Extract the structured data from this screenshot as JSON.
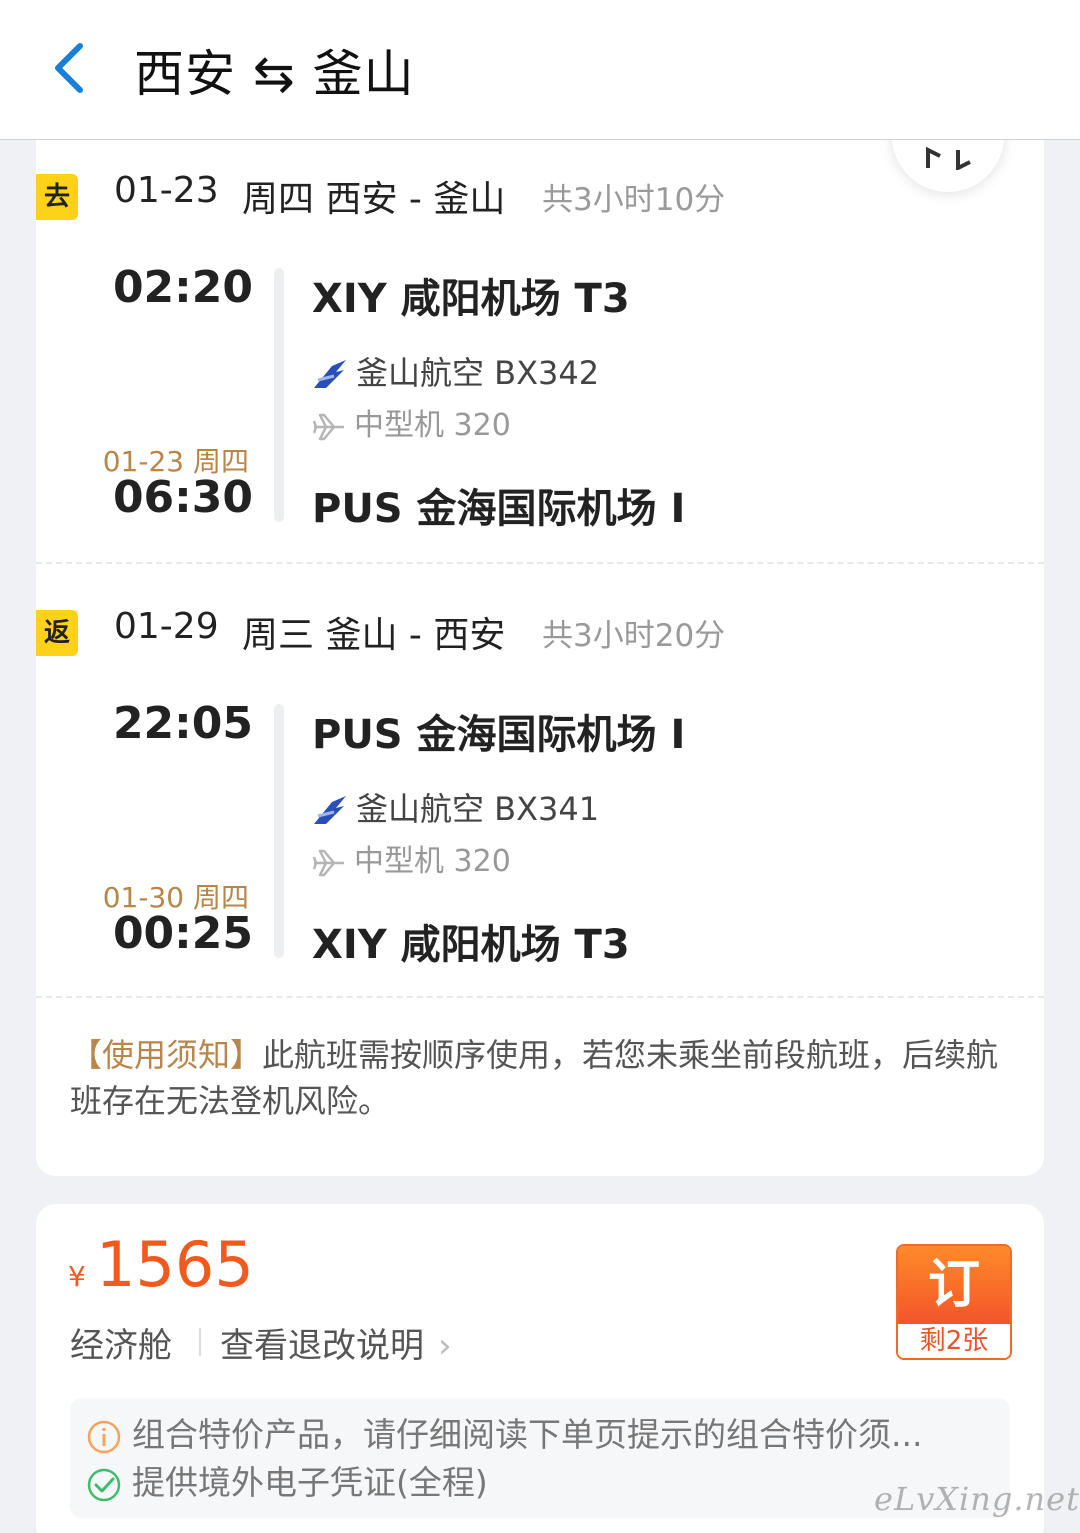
{
  "header": {
    "title": "西安 ⇆ 釜山"
  },
  "outbound": {
    "badge": "去",
    "date": "01-23",
    "route": "周四 西安 - 釜山",
    "duration": "共3小时10分",
    "dep_time": "02:20",
    "dep_airport": "XIY 咸阳机场 T3",
    "airline": "釜山航空 BX342",
    "aircraft": "中型机 320",
    "arr_date": "01-23 周四",
    "arr_time": "06:30",
    "arr_airport": "PUS 金海国际机场 I"
  },
  "return": {
    "badge": "返",
    "date": "01-29",
    "route": "周三 釜山 - 西安",
    "duration": "共3小时20分",
    "dep_time": "22:05",
    "dep_airport": "PUS 金海国际机场 I",
    "airline": "釜山航空 BX341",
    "aircraft": "中型机 320",
    "arr_date": "01-30 周四",
    "arr_time": "00:25",
    "arr_airport": "XIY 咸阳机场 T3"
  },
  "notice": {
    "label": "【使用须知】",
    "text": "此航班需按顺序使用，若您未乘坐前段航班，后续航班存在无法登机风险。"
  },
  "price": {
    "currency": "¥",
    "amount": "1565",
    "cabin": "经济舱",
    "refund_link": "查看退改说明",
    "book_label": "订",
    "remaining": "剩2张"
  },
  "tips": {
    "combo": "组合特价产品，请仔细阅读下单页提示的组合特价须...",
    "voucher": "提供境外电子凭证(全程)"
  },
  "watermark": "eLvXing.net",
  "colors": {
    "accent_blue": "#1a7fd6",
    "price_orange": "#f05a1f",
    "gold": "#b8864a",
    "badge_yellow": "#ffd21a"
  }
}
